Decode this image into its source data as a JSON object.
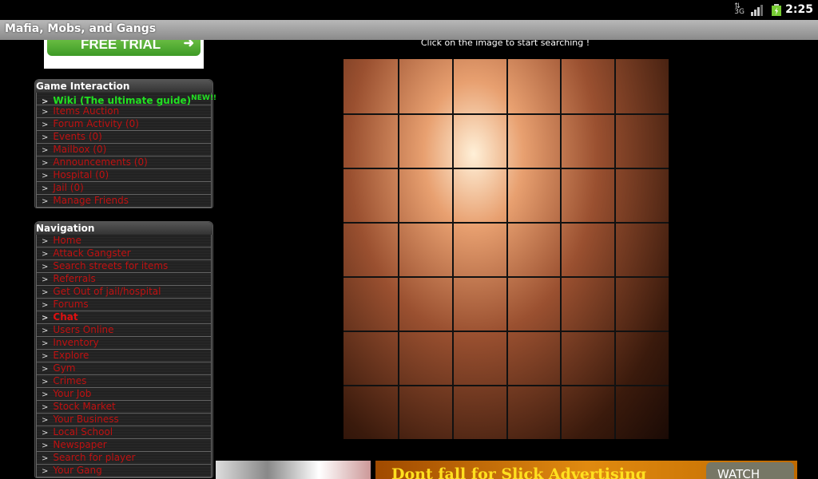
{
  "status_bar": {
    "time": "2:25",
    "network": "3G",
    "icons": [
      "data-arrows-icon",
      "signal-icon",
      "battery-icon"
    ]
  },
  "title": "Mafia, Mobs, and Gangs",
  "ad_top": {
    "label": "FREE TRIAL"
  },
  "game_interaction": {
    "title": "Game Interaction",
    "items": [
      {
        "label": "Wiki (The ultimate guide)",
        "badge": "NEW!!"
      },
      {
        "label": "Items Auction"
      },
      {
        "label": "Forum Activity (0)"
      },
      {
        "label": "Events (0)"
      },
      {
        "label": "Mailbox (0)"
      },
      {
        "label": "Announcements (0)"
      },
      {
        "label": "Hospital (0)"
      },
      {
        "label": "Jail (0)"
      },
      {
        "label": "Manage Friends"
      }
    ]
  },
  "navigation": {
    "title": "Navigation",
    "items": [
      {
        "label": "Home"
      },
      {
        "label": "Attack Gangster"
      },
      {
        "label": "Search streets for items"
      },
      {
        "label": "Referrals"
      },
      {
        "label": "Get Out of jail/hospital"
      },
      {
        "label": "Forums"
      },
      {
        "label": "Chat"
      },
      {
        "label": "Users Online"
      },
      {
        "label": "Inventory"
      },
      {
        "label": "Explore"
      },
      {
        "label": "Gym"
      },
      {
        "label": "Crimes"
      },
      {
        "label": "Your Job"
      },
      {
        "label": "Stock Market"
      },
      {
        "label": "Your Business"
      },
      {
        "label": "Local School"
      },
      {
        "label": "Newspaper"
      },
      {
        "label": "Search for player"
      },
      {
        "label": "Your Gang"
      }
    ]
  },
  "main": {
    "hint": "Click on the image to start searching !",
    "grid": {
      "rows": 7,
      "cols": 6
    }
  },
  "banner": {
    "text": "Dont fall for Slick Advertising",
    "button": "WATCH"
  },
  "colors": {
    "link": "#c01010",
    "highlight": "#22e022"
  }
}
